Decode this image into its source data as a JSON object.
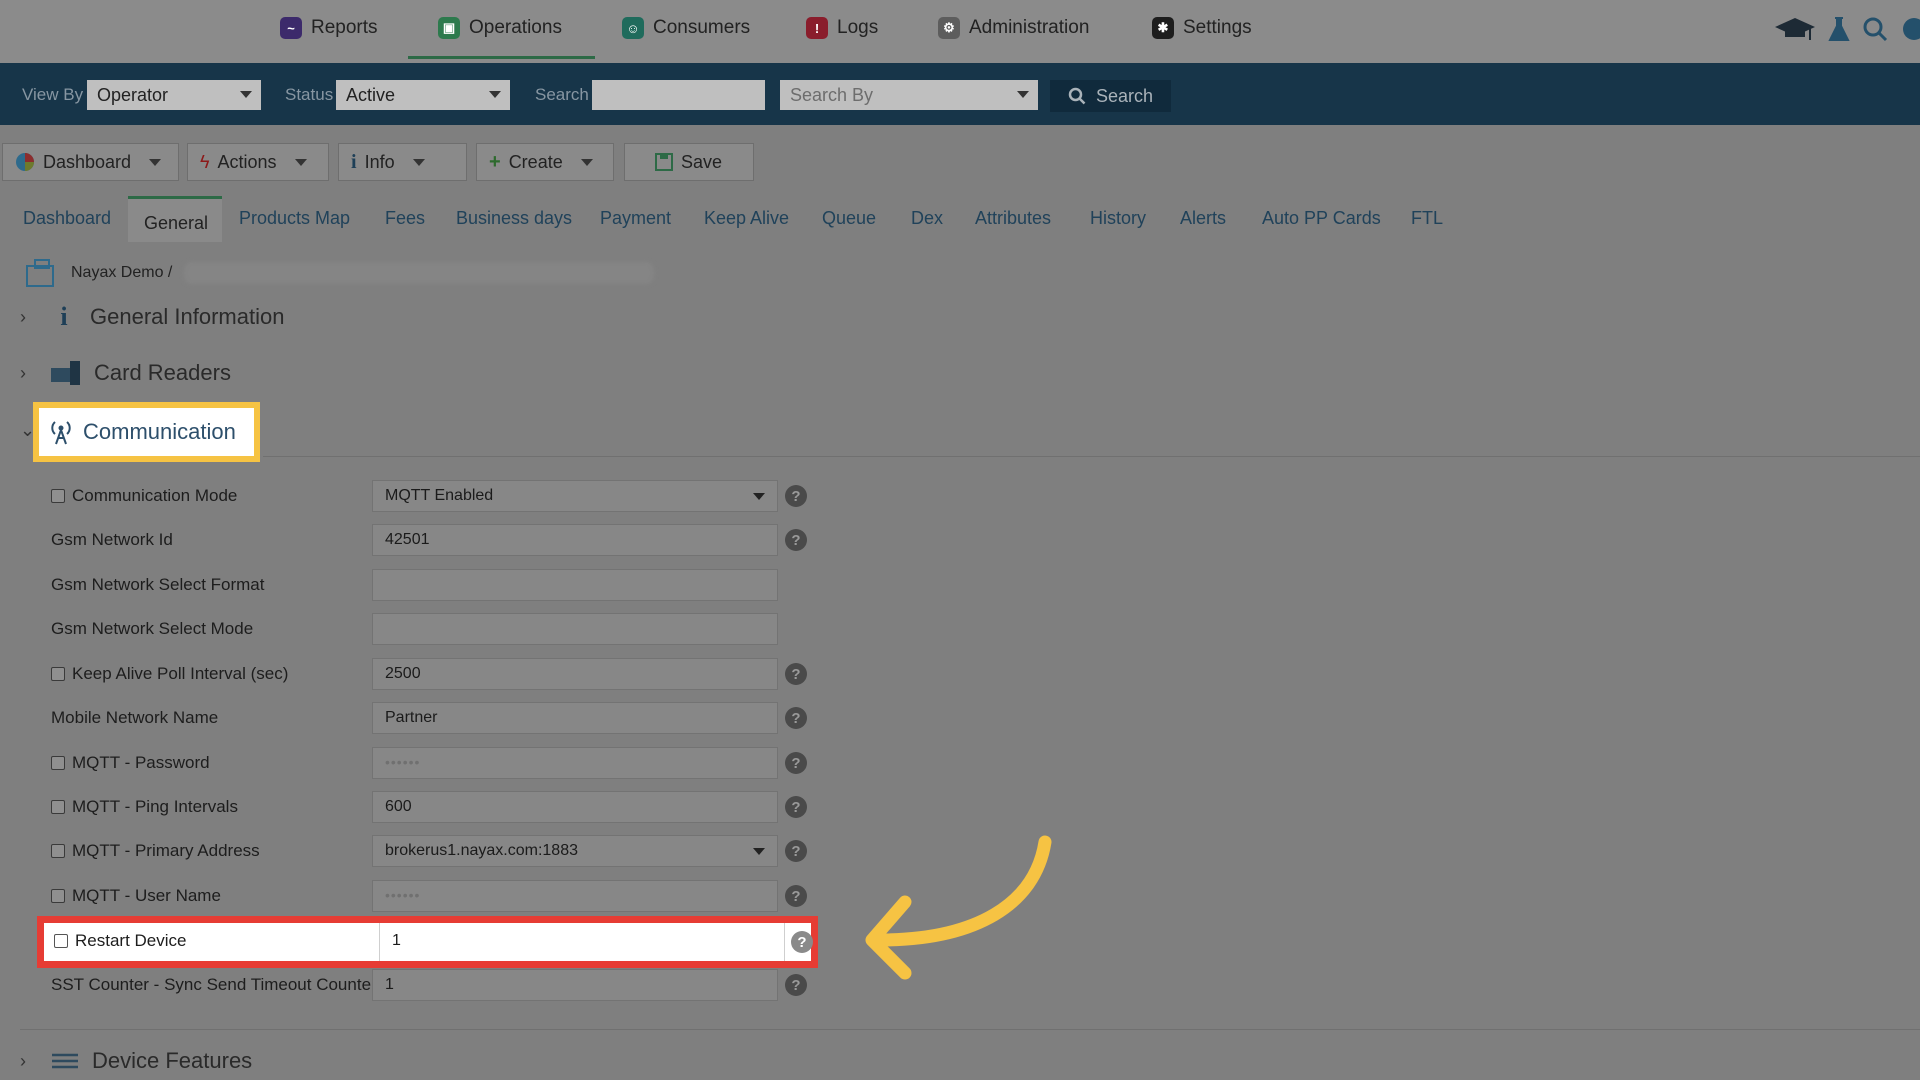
{
  "topnav": {
    "items": [
      {
        "label": "Reports",
        "color": "#3c2a6b"
      },
      {
        "label": "Operations",
        "color": "#2d7a4d"
      },
      {
        "label": "Consumers",
        "color": "#1f6b5c"
      },
      {
        "label": "Logs",
        "color": "#8a1d2c"
      },
      {
        "label": "Administration",
        "color": "#5d5d5d"
      },
      {
        "label": "Settings",
        "color": "#1d1d1d"
      }
    ],
    "active_index": 1
  },
  "filterbar": {
    "view_by_label": "View By",
    "view_by_value": "Operator",
    "status_label": "Status",
    "status_value": "Active",
    "search_label": "Search",
    "search_value": "",
    "search_by_placeholder": "Search By",
    "search_button": "Search"
  },
  "toolbar": {
    "dashboard": "Dashboard",
    "actions": "Actions",
    "info": "Info",
    "create": "Create",
    "save": "Save"
  },
  "tabs": [
    "Dashboard",
    "General",
    "Products Map",
    "Fees",
    "Business days",
    "Payment",
    "Keep Alive",
    "Queue",
    "Dex",
    "Attributes",
    "History",
    "Alerts",
    "Auto PP Cards",
    "FTL"
  ],
  "active_tab": "General",
  "breadcrumb": "Nayax Demo /",
  "sections": {
    "general_information": "General Information",
    "card_readers": "Card Readers",
    "communication": "Communication",
    "device_features": "Device Features"
  },
  "fields": [
    {
      "label": "Communication Mode",
      "checkbox": true,
      "value": "MQTT Enabled",
      "dropdown": true,
      "help": true
    },
    {
      "label": "Gsm Network Id",
      "checkbox": false,
      "value": "42501",
      "dropdown": false,
      "help": true
    },
    {
      "label": "Gsm Network Select Format",
      "checkbox": false,
      "value": "",
      "dropdown": false,
      "help": false
    },
    {
      "label": "Gsm Network Select Mode",
      "checkbox": false,
      "value": "",
      "dropdown": false,
      "help": false
    },
    {
      "label": "Keep Alive Poll Interval (sec)",
      "checkbox": true,
      "value": "2500",
      "dropdown": false,
      "help": true
    },
    {
      "label": "Mobile Network Name",
      "checkbox": false,
      "value": "Partner",
      "dropdown": false,
      "help": true
    },
    {
      "label": "MQTT - Password",
      "checkbox": true,
      "value": "••••••",
      "dropdown": false,
      "help": true
    },
    {
      "label": "MQTT - Ping Intervals",
      "checkbox": true,
      "value": "600",
      "dropdown": false,
      "help": true
    },
    {
      "label": "MQTT - Primary Address",
      "checkbox": true,
      "value": "brokerus1.nayax.com:1883",
      "dropdown": true,
      "help": true
    },
    {
      "label": "MQTT - User Name",
      "checkbox": true,
      "value": "••••••",
      "dropdown": false,
      "help": true
    },
    {
      "label": "Restart Device",
      "checkbox": true,
      "value": "1",
      "dropdown": false,
      "help": true
    },
    {
      "label": "SST Counter - Sync Send Timeout Counter",
      "checkbox": false,
      "value": "1",
      "dropdown": false,
      "help": true
    }
  ],
  "help_glyph": "?",
  "colors": {
    "highlight_yellow": "#f6c343",
    "highlight_red": "#e63c34",
    "arrow": "#f6c343"
  }
}
